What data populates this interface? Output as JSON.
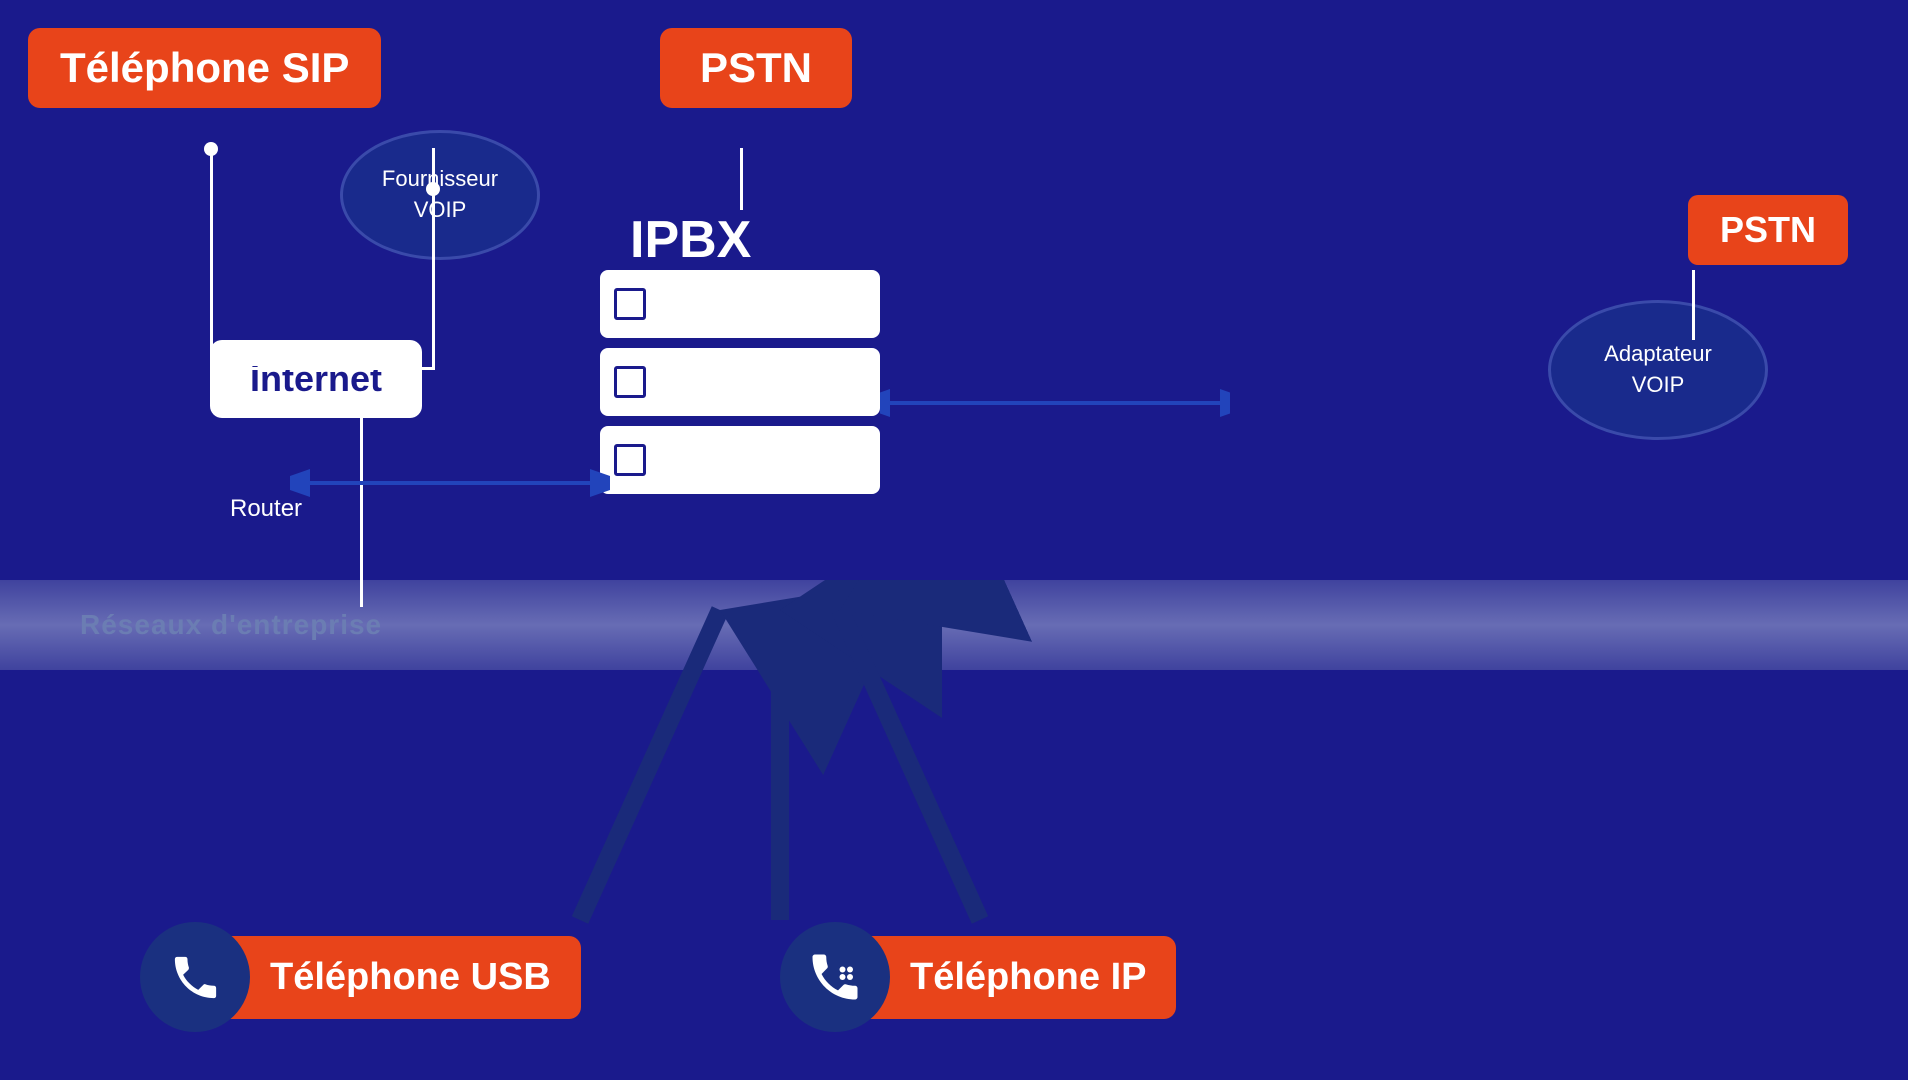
{
  "badges": {
    "telephone_sip": "Téléphone SIP",
    "pstn_top": "PSTN",
    "pstn_right": "PSTN",
    "ipbx": "IPBX",
    "internet": "Internet",
    "router_label": "Router",
    "voip_provider": "Fournisseur\nVOIP",
    "adaptateur_voip": "Adaptateur\nVOIP",
    "reseau_entreprise": "Réseaux d'entreprise",
    "telephone_usb": "Téléphone USB",
    "telephone_ip": "Téléphone IP"
  },
  "colors": {
    "background": "#1a1a8c",
    "orange": "#e8441a",
    "white": "#ffffff",
    "dark_blue": "#1a3080",
    "arrow_blue": "#2244bb"
  }
}
